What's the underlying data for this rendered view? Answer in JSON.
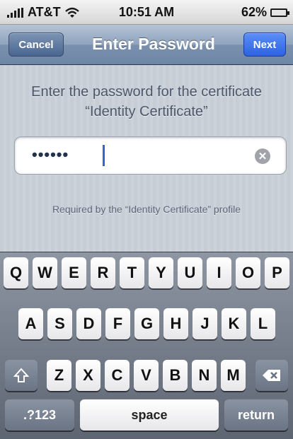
{
  "status_bar": {
    "carrier": "AT&T",
    "time": "10:51 AM",
    "battery_percent": "62%",
    "battery_level": 0.62,
    "signal_icon": "signal-bars-icon",
    "wifi_icon": "wifi-icon",
    "battery_icon": "battery-icon"
  },
  "nav": {
    "cancel_label": "Cancel",
    "title": "Enter Password",
    "next_label": "Next"
  },
  "content": {
    "prompt_line1": "Enter the password for the certificate",
    "prompt_line2": "“Identity Certificate”",
    "password_value": "••••••",
    "clear_icon": "clear-icon",
    "required_text": "Required by the “Identity Certificate” profile"
  },
  "keyboard": {
    "row1": [
      "Q",
      "W",
      "E",
      "R",
      "T",
      "Y",
      "U",
      "I",
      "O",
      "P"
    ],
    "row2": [
      "A",
      "S",
      "D",
      "F",
      "G",
      "H",
      "J",
      "K",
      "L"
    ],
    "row3": [
      "Z",
      "X",
      "C",
      "V",
      "B",
      "N",
      "M"
    ],
    "shift_icon": "shift-icon",
    "delete_icon": "delete-icon",
    "numbers_label": ".?123",
    "space_label": "space",
    "return_label": "return"
  }
}
